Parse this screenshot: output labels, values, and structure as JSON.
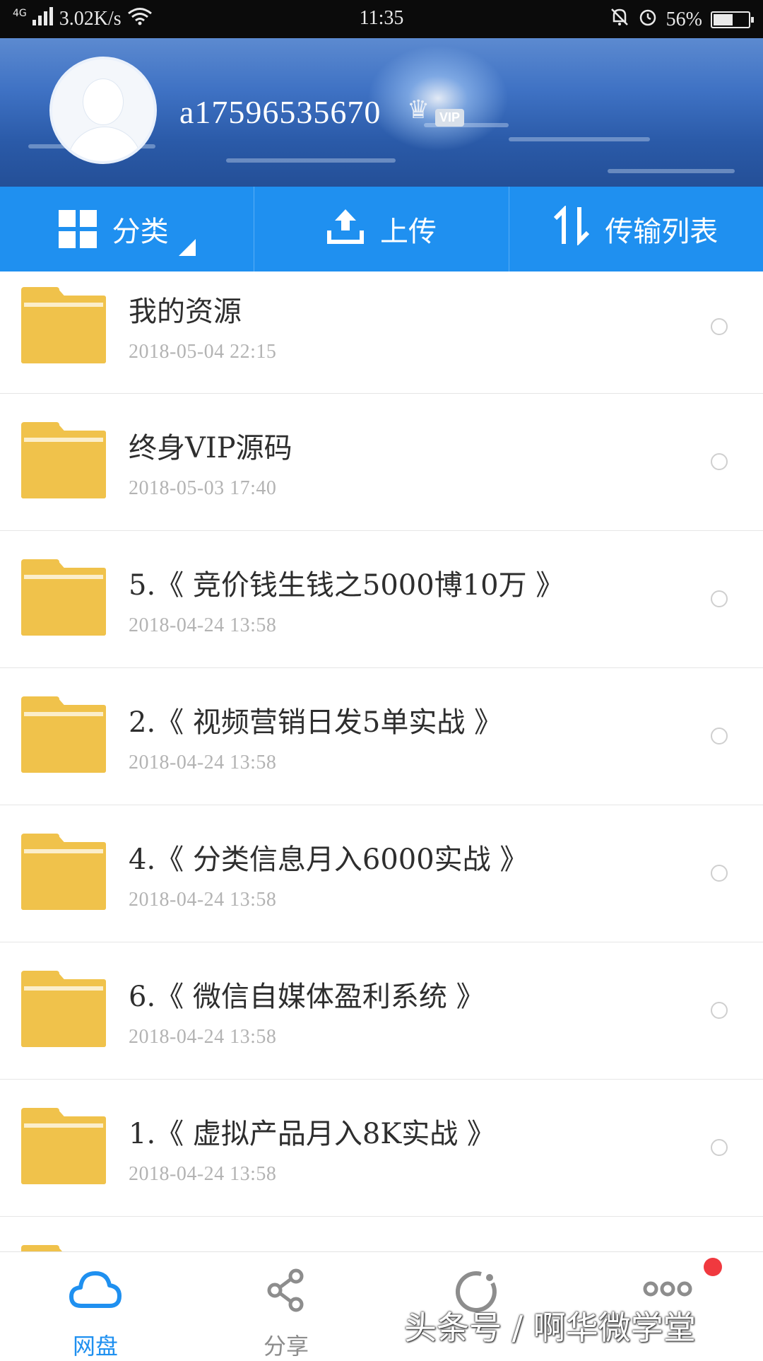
{
  "status_bar": {
    "network_type": "4G",
    "speed": "3.02K/s",
    "time": "11:35",
    "battery": "56%",
    "battery_level": 0.56
  },
  "profile": {
    "username": "a17596535670",
    "vip_label": "VIP"
  },
  "actions": {
    "category": "分类",
    "upload": "上传",
    "transfer_list": "传输列表"
  },
  "files": [
    {
      "name": "我的资源",
      "date": "2018-05-04  22:15"
    },
    {
      "name": "终身VIP源码",
      "date": "2018-05-03  17:40"
    },
    {
      "name": "5.《 竞价钱生钱之5000博10万 》",
      "date": "2018-04-24  13:58"
    },
    {
      "name": "2.《 视频营销日发5单实战 》",
      "date": "2018-04-24  13:58"
    },
    {
      "name": "4.《 分类信息月入6000实战 》",
      "date": "2018-04-24  13:58"
    },
    {
      "name": "6.《 微信自媒体盈利系统 》",
      "date": "2018-04-24  13:58"
    },
    {
      "name": "1.《 虚拟产品月入8K实战 》",
      "date": "2018-04-24  13:58"
    }
  ],
  "bottom_nav": {
    "disk": "网盘",
    "share": "分享"
  },
  "watermark": "头条号 / 啊华微学堂",
  "colors": {
    "accent": "#1f90f0",
    "folder": "#f0c24b",
    "badge": "#f0393f"
  }
}
